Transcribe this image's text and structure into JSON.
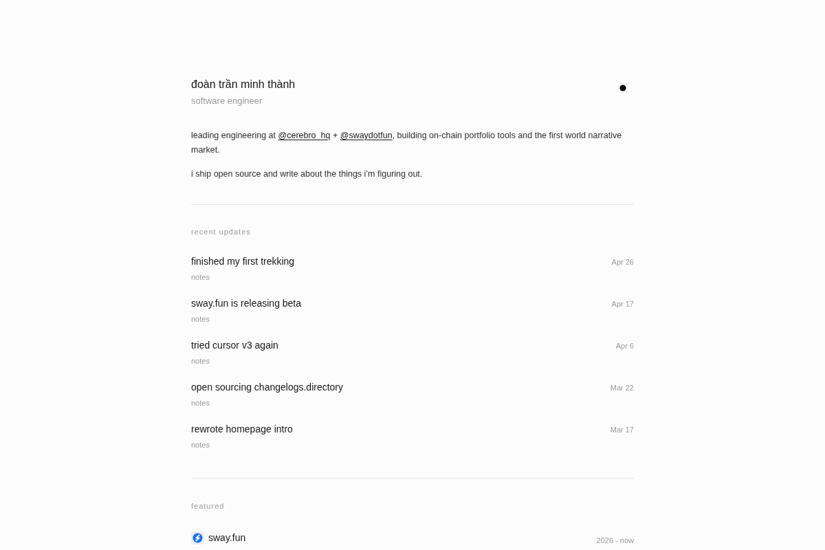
{
  "header": {
    "name": "đoàn trần minh thành",
    "role": "software engineer"
  },
  "bio": [
    {
      "parts": [
        {
          "kind": "text",
          "text": "leading engineering at "
        },
        {
          "kind": "link",
          "text": "@cerebro_hq"
        },
        {
          "kind": "text",
          "text": " + "
        },
        {
          "kind": "link",
          "text": "@swaydotfun"
        },
        {
          "kind": "text",
          "text": ", building on-chain portfolio tools and the first world narrative market."
        }
      ]
    },
    {
      "parts": [
        {
          "kind": "text",
          "text": "i ship open source and write about the things i’m figuring out."
        }
      ]
    }
  ],
  "recent_updates": {
    "heading": "recent updates",
    "items": [
      {
        "title": "finished my first trekking",
        "category": "notes",
        "date": "Apr 26"
      },
      {
        "title": "sway.fun is releasing beta",
        "category": "notes",
        "date": "Apr 17"
      },
      {
        "title": "tried cursor v3 again",
        "category": "notes",
        "date": "Apr 6"
      },
      {
        "title": "open sourcing changelogs.directory",
        "category": "notes",
        "date": "Mar 22"
      },
      {
        "title": "rewrote homepage intro",
        "category": "notes",
        "date": "Mar 17"
      }
    ]
  },
  "featured": {
    "heading": "featured",
    "items": [
      {
        "name": "sway.fun",
        "period": "2026 - now"
      }
    ]
  }
}
